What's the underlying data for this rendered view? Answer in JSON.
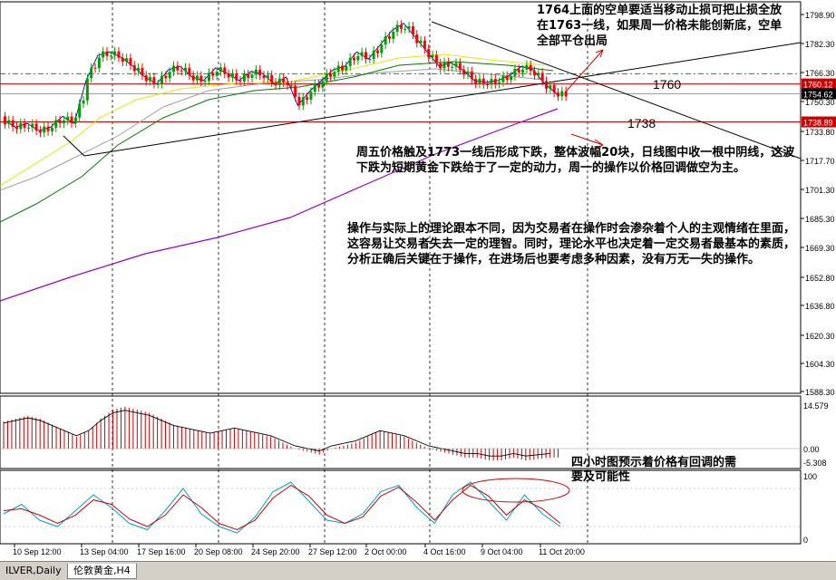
{
  "chart_data": {
    "type": "candlestick",
    "price_axis": {
      "ticks": [
        "1798.90",
        "1782.30",
        "1766.30",
        "1750.30",
        "1733.80",
        "1717.70",
        "1701.30",
        "1685.30",
        "1669.30",
        "1652.80",
        "1636.80",
        "1620.30",
        "1604.30",
        "1588.30"
      ],
      "current_price": "1754.62",
      "level_labels": [
        "1760.12",
        "1738.89"
      ]
    },
    "macd_axis": {
      "ticks": [
        "14.579",
        "0.00",
        "-5.308"
      ]
    },
    "stoch_axis": {
      "ticks": [
        "100",
        "0"
      ]
    },
    "time_axis": {
      "ticks": [
        "10 Sep 12:00",
        "13 Sep 04:00",
        "17 Sep 16:00",
        "20 Sep 08:00",
        "24 Sep 20:00",
        "27 Sep 12:00",
        "2 Oct 00:00",
        "4 Oct 16:00",
        "9 Oct 04:00",
        "11 Oct 20:00"
      ]
    },
    "level_annotations": [
      "1760",
      "1738"
    ],
    "close_path": [
      1740,
      1736,
      1738,
      1734,
      1736,
      1742,
      1738,
      1762,
      1776,
      1778,
      1775,
      1770,
      1764,
      1760,
      1768,
      1770,
      1764,
      1762,
      1769,
      1766,
      1762,
      1767,
      1766,
      1760,
      1764,
      1748,
      1756,
      1762,
      1768,
      1770,
      1778,
      1774,
      1782,
      1790,
      1794,
      1786,
      1778,
      1770,
      1772,
      1768,
      1762,
      1761,
      1762,
      1765,
      1770,
      1768,
      1760,
      1754.62
    ],
    "macd": [
      9,
      10,
      11,
      10,
      8,
      6,
      4,
      6,
      10,
      13,
      14,
      13,
      12,
      10,
      8,
      7,
      6,
      5,
      6,
      7,
      6,
      5,
      4,
      2,
      0,
      -1,
      -2,
      0,
      1,
      2,
      4,
      6,
      5,
      4,
      2,
      0,
      -1,
      -2,
      -3,
      -3,
      -4,
      -4,
      -3,
      -4,
      -3.5,
      -3
    ],
    "stochastic_main": [
      40,
      55,
      30,
      20,
      45,
      70,
      50,
      25,
      15,
      45,
      80,
      40,
      20,
      10,
      35,
      75,
      90,
      60,
      30,
      25,
      40,
      75,
      85,
      50,
      25,
      70,
      90,
      60,
      30,
      70,
      40,
      20
    ],
    "stochastic_signal": [
      45,
      48,
      38,
      25,
      38,
      62,
      55,
      32,
      20,
      38,
      70,
      50,
      25,
      15,
      30,
      65,
      85,
      68,
      38,
      25,
      35,
      68,
      82,
      58,
      30,
      62,
      85,
      68,
      38,
      62,
      48,
      25
    ]
  },
  "annotations": {
    "top_right": "1764上面的空单要适当移动止损可把止损全放在1763一线，如果周一价格未能创新底，空单全部平仓出局",
    "middle": "周五价格触及1773一线后形成下跌，整体波幅20块，日线图中收一根中阴线，这波下跌为短期黄金下跌给于了一定的动力，周一的操作以价格回调做空为主。",
    "lower": "操作与实际上的理论跟本不同，因为交易者在操作时会渗杂着个人的主观情绪在里面，这容易让交易者失去一定的理智。同时，理论水平也决定着一定交易者最基本的素质，分析正确后关键在于操作，在进场后也要考虑多种因素，没有万无一失的操作。",
    "indicator_note": "四小时图预示着价格有回调的需要及可能性"
  },
  "tabs": [
    "ILVER,Daily",
    "伦敦黄金,H4"
  ],
  "colors": {
    "up": "#00a000",
    "down": "#ff0000",
    "ma_yellow": "#e6e600",
    "ma_green": "#007a00",
    "ma_purple": "#9900cc",
    "ma_gray": "#a0a0a0",
    "hist": "#cc0000",
    "stoch_main": "#00a0c8",
    "stoch_signal": "#cc0000",
    "level_red": "#d00000"
  }
}
